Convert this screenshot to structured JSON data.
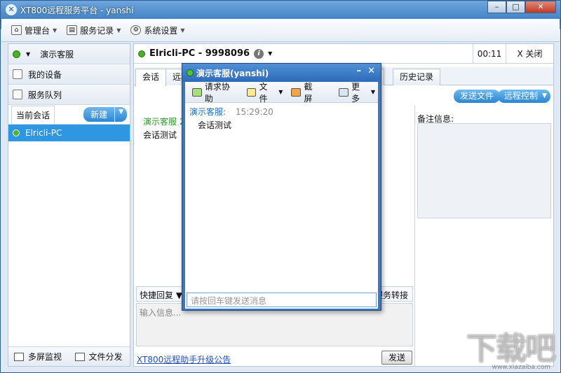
{
  "window": {
    "title": "XT800远程服务平台 - yanshi",
    "logo_glyph": "✕"
  },
  "menubar": {
    "items": [
      {
        "label": "管理台",
        "icon": "home-icon",
        "has_dropdown": true
      },
      {
        "label": "服务记录",
        "icon": "record-icon",
        "has_dropdown": true
      },
      {
        "label": "系统设置",
        "icon": "gear-icon",
        "has_dropdown": true
      }
    ]
  },
  "sidebar": {
    "agent": "演示客服",
    "items": [
      "我的设备",
      "服务队列"
    ],
    "session_tab": "当前会话",
    "new_button": "新建",
    "sessions": [
      "Elricli-PC"
    ],
    "bottom": [
      "多屏监视",
      "文件分发"
    ]
  },
  "connection": {
    "name": "Elricli-PC - 9998096",
    "timer": "00:11",
    "close": "X 关闭"
  },
  "tabs": [
    "会话",
    "远程",
    "息",
    "历史记录"
  ],
  "actions": {
    "send_file": "发送文件",
    "remote_control": "远程控制"
  },
  "chat": {
    "sender": "演示客服 20",
    "message": "会话测试"
  },
  "notes": {
    "label": "备注信息:"
  },
  "quickbar": {
    "quick_reply": "快捷回复",
    "transfer": "服务转接"
  },
  "input": {
    "placeholder": "输入信息..."
  },
  "footer": {
    "link": "XT800远程助手升级公告",
    "send": "发送"
  },
  "dialog": {
    "title": "演示客服(yanshi)",
    "toolbar": [
      "请求协助",
      "文件",
      "截屏",
      "更多"
    ],
    "msg_sender": "演示客服:",
    "msg_time": "15:29:20",
    "msg_body": "会话测试",
    "input_placeholder": "请按回车键发送消息"
  },
  "watermark": {
    "text": "下载吧",
    "sub": "www.xiazaiba.com"
  },
  "colors": {
    "accent": "#2f97e2",
    "online": "#4caf28"
  }
}
